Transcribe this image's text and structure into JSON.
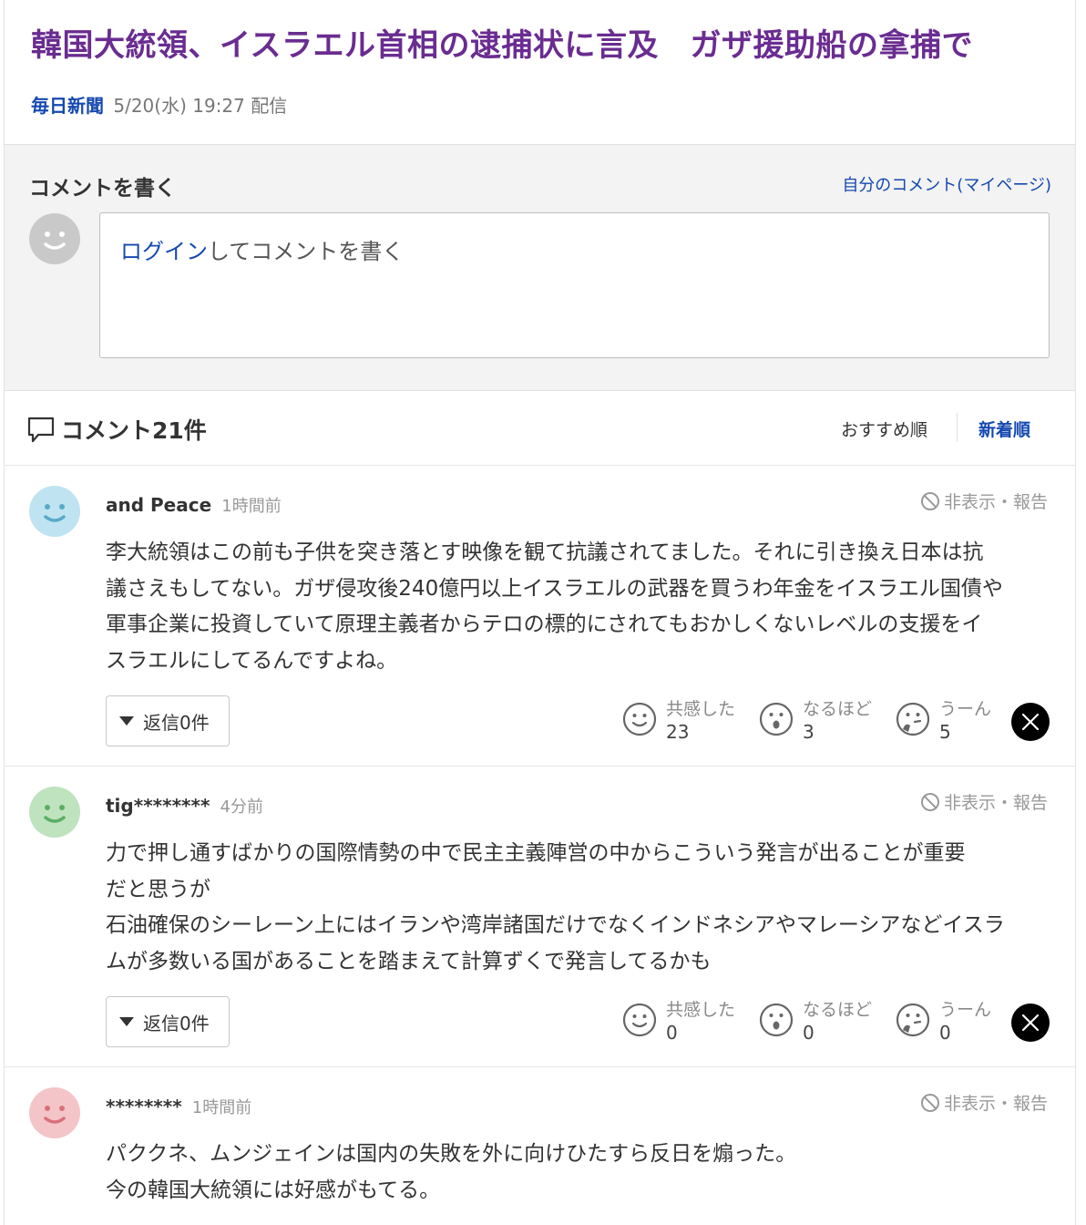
{
  "article": {
    "title": "韓国大統領、イスラエル首相の逮捕状に言及　ガザ援助船の拿捕で",
    "source": "毎日新聞",
    "published": "5/20(水) 19:27 配信"
  },
  "write_comment": {
    "heading": "コメントを書く",
    "mypage_link": "自分のコメント(マイページ)",
    "login_link": "ログイン",
    "prompt_suffix": "してコメントを書く"
  },
  "comment_list": {
    "count_label": "コメント21件",
    "sort_recommended": "おすすめ順",
    "sort_newest": "新着順"
  },
  "labels": {
    "report": "非表示・報告",
    "reaction_empathy": "共感した",
    "reaction_insight": "なるほど",
    "reaction_hmm": "うーん"
  },
  "colors": {
    "title": "#6a2c91",
    "link": "#1448b0",
    "avatar_blue": "#bfe3f1",
    "avatar_green": "#bfe3bf",
    "avatar_pink": "#f3c5c8"
  },
  "comments": [
    {
      "author": "and Peace",
      "time": "1時間前",
      "avatar_color": "#bfe3f1",
      "avatar_face": "#5aa9c8",
      "lines": [
        "李大統領はこの前も子供を突き落とす映像を観て抗議されてました。それに引き換え日本は抗",
        "議さえもしてない。ガザ侵攻後240億円以上イスラエルの武器を買うわ年金をイスラエル国債や",
        "軍事企業に投資していて原理主義者からテロの標的にされてもおかしくないレベルの支援をイ",
        "スラエルにしてるんですよね。"
      ],
      "reply_label": "返信0件",
      "empathy": "23",
      "insight": "3",
      "hmm": "5"
    },
    {
      "author": "tig********",
      "time": "4分前",
      "avatar_color": "#bfe3bf",
      "avatar_face": "#5cae66",
      "lines": [
        "力で押し通すばかりの国際情勢の中で民主主義陣営の中からこういう発言が出ることが重要",
        "だと思うが",
        "石油確保のシーレーン上にはイランや湾岸諸国だけでなくインドネシアやマレーシアなどイスラ",
        "ムが多数いる国があることを踏まえて計算ずくで発言してるかも"
      ],
      "reply_label": "返信0件",
      "empathy": "0",
      "insight": "0",
      "hmm": "0"
    },
    {
      "author": "********",
      "time": "1時間前",
      "avatar_color": "#f3c5c8",
      "avatar_face": "#d9707b",
      "lines": [
        "パククネ、ムンジェインは国内の失敗を外に向けひたすら反日を煽った。",
        "今の韓国大統領には好感がもてる。"
      ]
    }
  ]
}
